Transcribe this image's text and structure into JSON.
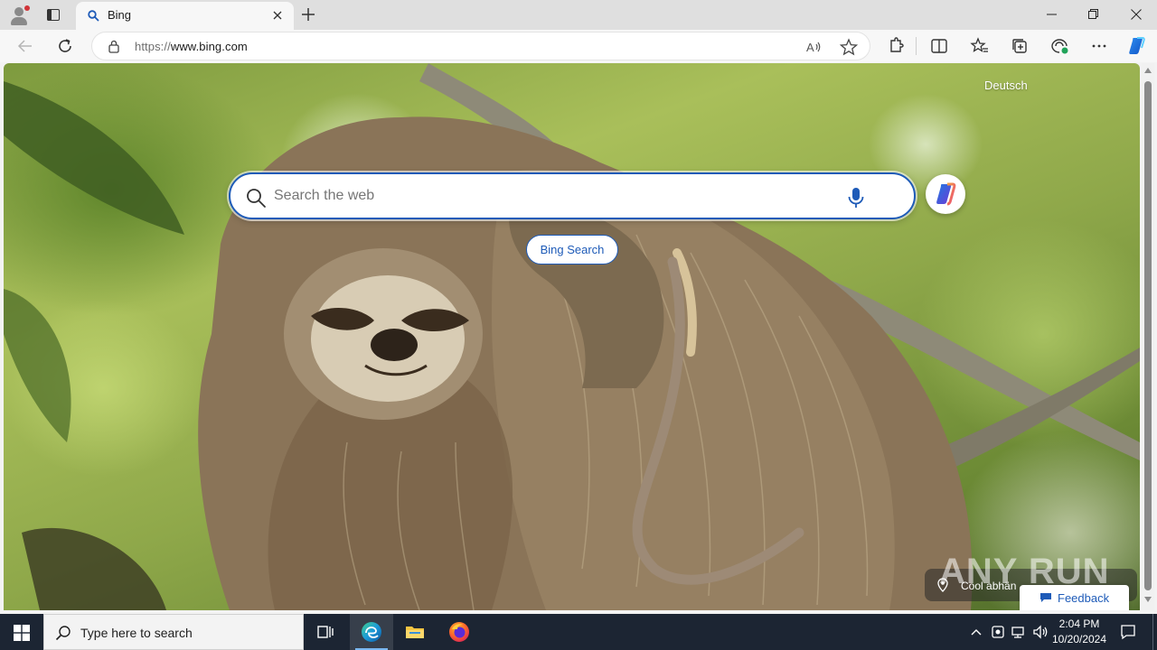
{
  "browser": {
    "tab": {
      "title": "Bing"
    },
    "address_bar": {
      "url_prefix": "https://",
      "url_host": "www.bing.com"
    }
  },
  "page": {
    "language_link": "Deutsch",
    "search": {
      "placeholder": "Search the web"
    },
    "bing_search_button": "Bing Search",
    "location_label": "Cool abhän",
    "watermark": "ANY RUN",
    "feedback_label": "Feedback"
  },
  "taskbar": {
    "search_placeholder": "Type here to search",
    "time": "2:04 PM",
    "date": "10/20/2024"
  },
  "colors": {
    "accent": "#1e5bb8",
    "taskbar": "#1c2533"
  }
}
